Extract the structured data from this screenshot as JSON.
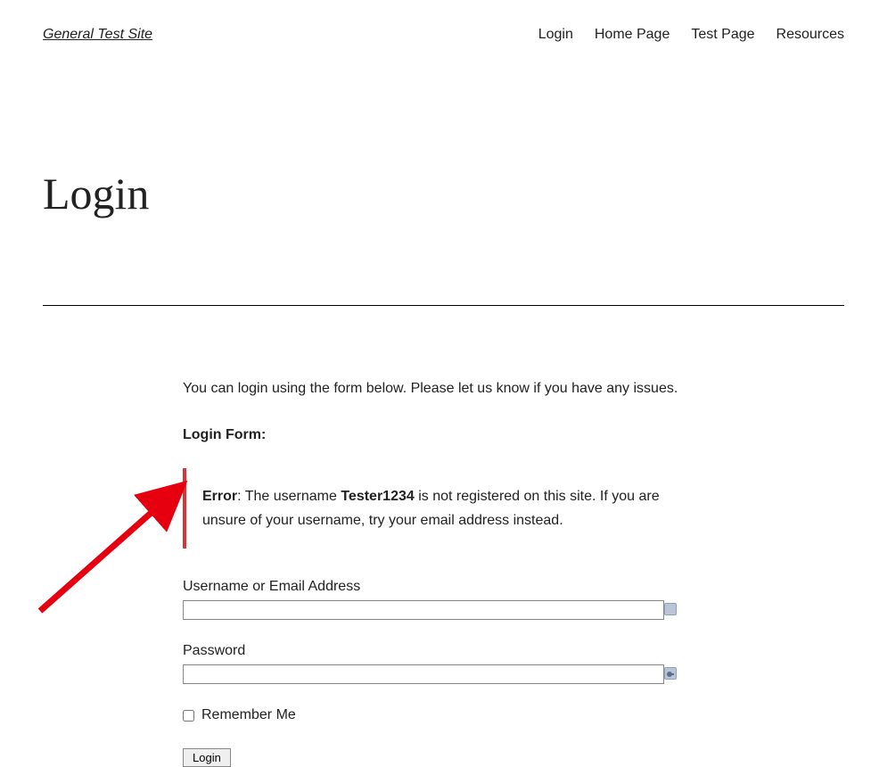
{
  "header": {
    "site_title": "General Test Site",
    "nav": {
      "login": "Login",
      "home": "Home Page",
      "test": "Test Page",
      "resources": "Resources"
    }
  },
  "page": {
    "title": "Login",
    "intro": "You can login using the form below. Please let us know if you have any issues.",
    "form_heading": "Login Form:"
  },
  "error": {
    "label": "Error",
    "pre_username": ": The username ",
    "username": "Tester1234",
    "post_username": " is not registered on this site. If you are unsure of your username, try your email address instead."
  },
  "form": {
    "username_label": "Username or Email Address",
    "username_value": "",
    "password_label": "Password",
    "password_value": "",
    "remember_label": "Remember Me",
    "submit_label": "Login"
  }
}
